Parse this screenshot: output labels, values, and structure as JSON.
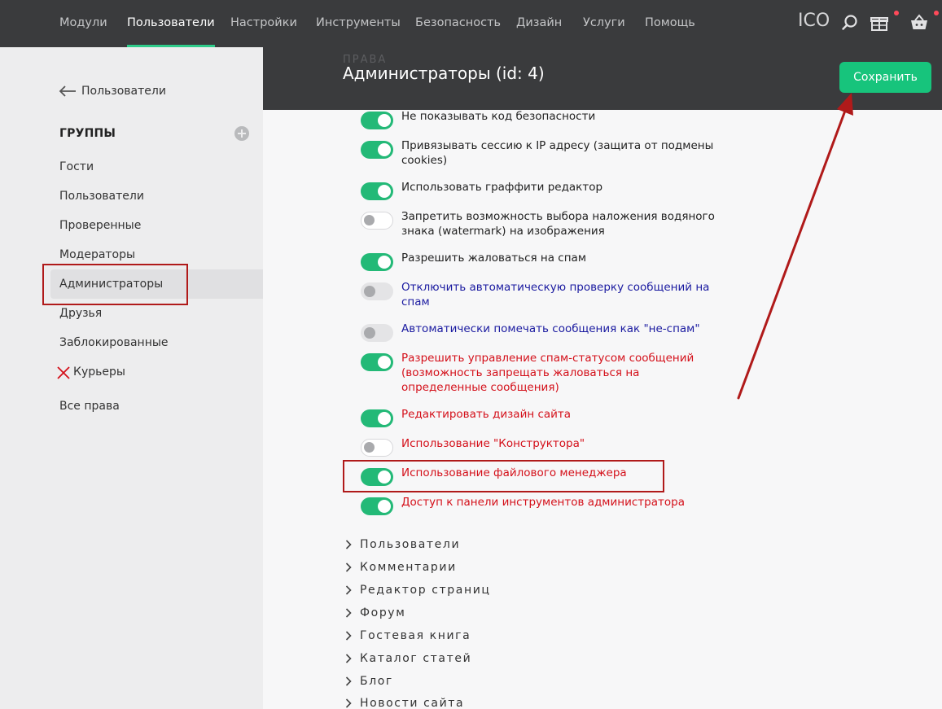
{
  "topnav": {
    "items": [
      {
        "label": "Модули"
      },
      {
        "label": "Пользователи",
        "active": true
      },
      {
        "label": "Настройки"
      },
      {
        "label": "Инструменты"
      },
      {
        "label": "Безопасность"
      },
      {
        "label": "Дизайн"
      },
      {
        "label": "Услуги"
      },
      {
        "label": "Помощь"
      }
    ],
    "ico_label": "ICO",
    "icons": [
      "search-icon",
      "gift-icon",
      "basket-icon"
    ],
    "accent": "#2ecc8a"
  },
  "sidebar": {
    "back_label": "Пользователи",
    "groups_title": "ГРУППЫ",
    "items": [
      {
        "label": "Гости"
      },
      {
        "label": "Пользователи"
      },
      {
        "label": "Проверенные"
      },
      {
        "label": "Модераторы"
      },
      {
        "label": "Администраторы",
        "active": true
      },
      {
        "label": "Друзья"
      },
      {
        "label": "Заблокированные"
      },
      {
        "label": "Курьеры"
      },
      {
        "label": "Все права"
      }
    ]
  },
  "header": {
    "title": "Администраторы (id: 4)",
    "ghost_label": "ПРАВА",
    "save_label": "Сохранить",
    "save_color": "#17c47c"
  },
  "permissions": [
    {
      "label": "Не показывать код безопасности",
      "state": "on",
      "color": "default"
    },
    {
      "label": "Привязывать сессию к IP адресу (защита от подмены cookies)",
      "state": "on",
      "color": "default"
    },
    {
      "label": "Использовать граффити редактор",
      "state": "on",
      "color": "default"
    },
    {
      "label": "Запретить возможность выбора наложения водяного знака (watermark) на изображения",
      "state": "off",
      "color": "default"
    },
    {
      "label": "Разрешить жаловаться на спам",
      "state": "on",
      "color": "default"
    },
    {
      "label": "Отключить автоматическую проверку сообщений на спам",
      "state": "disabled",
      "color": "blue"
    },
    {
      "label": "Автоматически помечать сообщения как \"не-спам\"",
      "state": "disabled",
      "color": "blue"
    },
    {
      "label": "Разрешить управление спам-статусом сообщений (возможность запрещать жаловаться на определенные сообщения)",
      "state": "on",
      "color": "red"
    },
    {
      "label": "Редактировать дизайн сайта",
      "state": "on",
      "color": "red"
    },
    {
      "label": "Использование \"Конструктора\"",
      "state": "off",
      "color": "red"
    },
    {
      "label": "Использование файлового менеджера",
      "state": "on",
      "color": "red"
    },
    {
      "label": "Доступ к панели инструментов администратора",
      "state": "on",
      "color": "red"
    }
  ],
  "sections": [
    {
      "label": "Пользователи"
    },
    {
      "label": "Комментарии"
    },
    {
      "label": "Редактор страниц"
    },
    {
      "label": "Форум"
    },
    {
      "label": "Гостевая книга"
    },
    {
      "label": "Каталог статей"
    },
    {
      "label": "Блог"
    },
    {
      "label": "Новости сайта"
    }
  ],
  "annotations": {
    "highlight_color": "#b01a1a"
  }
}
